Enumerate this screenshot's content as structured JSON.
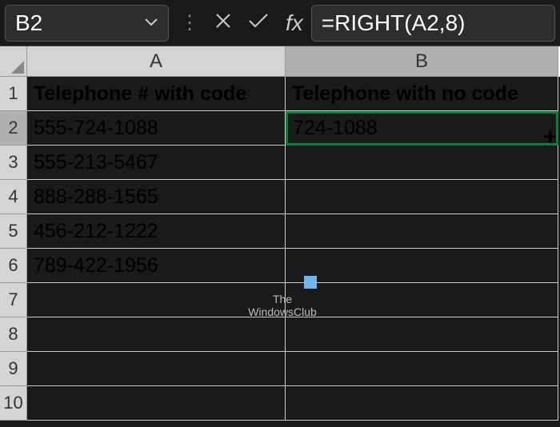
{
  "formulaBar": {
    "nameBox": "B2",
    "formula": "=RIGHT(A2,8)",
    "fxLabel": "fx"
  },
  "columns": {
    "a": "A",
    "b": "B"
  },
  "rows": [
    "1",
    "2",
    "3",
    "4",
    "5",
    "6",
    "7",
    "8",
    "9",
    "10"
  ],
  "cells": {
    "a1": "Telephone # with code",
    "b1": "Telephone with no code",
    "a2": "555-724-1088",
    "b2": "724-1088",
    "a3": "555-213-5467",
    "a4": "888-288-1565",
    "a5": "456-212-1222",
    "a6": "789-422-1956"
  },
  "watermark": {
    "line1": "The",
    "line2": "WindowsClub"
  },
  "chart_data": {
    "type": "table",
    "title": "Telephone numbers with and without area code",
    "columns": [
      "Telephone # with code",
      "Telephone with no code"
    ],
    "rows": [
      [
        "555-724-1088",
        "724-1088"
      ],
      [
        "555-213-5467",
        ""
      ],
      [
        "888-288-1565",
        ""
      ],
      [
        "456-212-1222",
        ""
      ],
      [
        "789-422-1956",
        ""
      ]
    ]
  }
}
